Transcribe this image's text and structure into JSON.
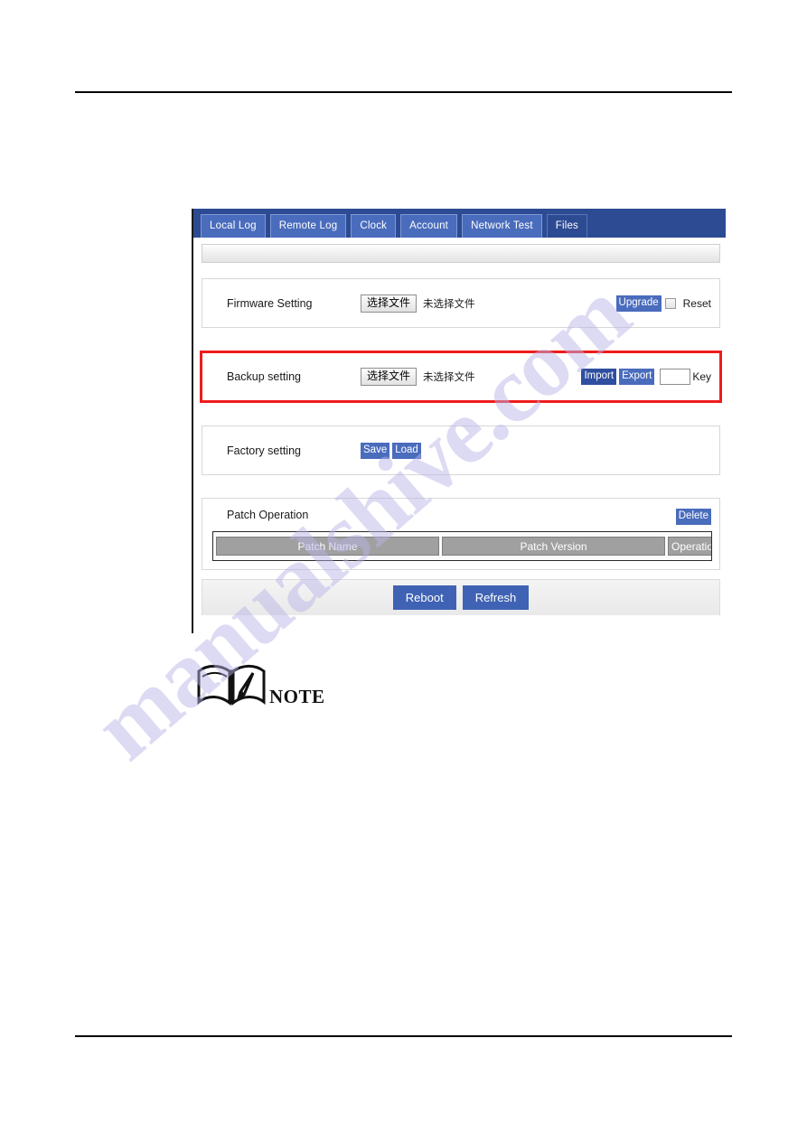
{
  "document": {
    "watermark_text": "manualshive.com",
    "note_label": "NOTE",
    "note_icon": "open-book-with-pencil-icon"
  },
  "screenshot": {
    "tabs": [
      {
        "label": "Local Log",
        "active": false
      },
      {
        "label": "Remote Log",
        "active": false
      },
      {
        "label": "Clock",
        "active": false
      },
      {
        "label": "Account",
        "active": false
      },
      {
        "label": "Network Test",
        "active": false
      },
      {
        "label": "Files",
        "active": true
      }
    ],
    "colors": {
      "header_blue": "#2c4b92",
      "tab_blue": "#4a6cbd",
      "button_blue": "#4a6cbd",
      "button_blue_dark": "#2f4fa0",
      "highlight_red": "#ef1c1c",
      "table_header_gray": "#a0a0a0"
    },
    "rows": {
      "firmware": {
        "label": "Firmware Setting",
        "file_button": "选择文件",
        "file_status": "未选择文件",
        "upgrade_button": "Upgrade",
        "reset_label": "Reset",
        "reset_checked": false
      },
      "backup": {
        "label": "Backup setting",
        "file_button": "选择文件",
        "file_status": "未选择文件",
        "import_button": "Import",
        "export_button": "Export",
        "key_value": "",
        "key_placeholder": "",
        "key_label": "Key",
        "highlighted": true
      },
      "factory": {
        "label": "Factory setting",
        "save_button": "Save",
        "load_button": "Load"
      },
      "patch": {
        "label": "Patch Operation",
        "delete_button": "Delete",
        "columns": [
          "Patch Name",
          "Patch Version",
          "Operation"
        ],
        "rows": []
      }
    },
    "footer": {
      "reboot_button": "Reboot",
      "refresh_button": "Refresh"
    }
  }
}
